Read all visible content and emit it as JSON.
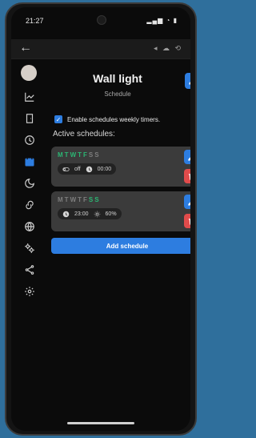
{
  "status": {
    "time": "21:27",
    "sys_icons": "▂▄▆  ◔  ▮"
  },
  "appbar": {
    "back_icon": "←",
    "right_icons": "◂ ☁ ⟲"
  },
  "sidebar": {
    "items": [
      {
        "name": "avatar"
      },
      {
        "name": "trend-icon"
      },
      {
        "name": "door-icon"
      },
      {
        "name": "clock-icon"
      },
      {
        "name": "calendar-icon"
      },
      {
        "name": "moon-icon"
      },
      {
        "name": "link-icon"
      },
      {
        "name": "globe-icon"
      },
      {
        "name": "gears-icon"
      },
      {
        "name": "share-icon"
      },
      {
        "name": "settings-icon"
      }
    ]
  },
  "page": {
    "title": "Wall light",
    "subtitle": "Schedule",
    "enable_label": "Enable schedules weekly timers.",
    "active_title": "Active schedules:",
    "add_label": "Add schedule"
  },
  "schedules": [
    {
      "days": [
        {
          "l": "M",
          "on": true
        },
        {
          "l": "T",
          "on": true
        },
        {
          "l": "W",
          "on": true
        },
        {
          "l": "T",
          "on": true
        },
        {
          "l": "F",
          "on": true
        },
        {
          "l": "S",
          "on": false
        },
        {
          "l": "S",
          "on": false
        }
      ],
      "state": "off",
      "time": "00:00"
    },
    {
      "days": [
        {
          "l": "M",
          "on": false
        },
        {
          "l": "T",
          "on": false
        },
        {
          "l": "W",
          "on": false
        },
        {
          "l": "T",
          "on": false
        },
        {
          "l": "F",
          "on": false
        },
        {
          "l": "S",
          "on": true
        },
        {
          "l": "S",
          "on": true
        }
      ],
      "time": "23:00",
      "brightness": "60%"
    }
  ],
  "colors": {
    "accent": "#2d7de0",
    "danger": "#e04b4b",
    "day_on": "#2bb673"
  }
}
